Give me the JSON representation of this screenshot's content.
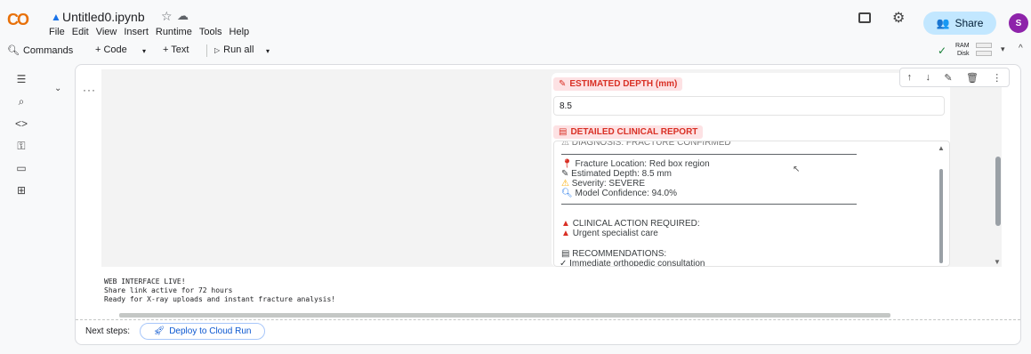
{
  "header": {
    "logo": "CO",
    "title": "Untitled0.ipynb",
    "menu": [
      "File",
      "Edit",
      "View",
      "Insert",
      "Runtime",
      "Tools",
      "Help"
    ],
    "share_label": "Share",
    "avatar_initial": "S"
  },
  "toolbar": {
    "commands_label": "Commands",
    "code_label": "+ Code",
    "text_label": "+ Text",
    "run_all_label": "Run all",
    "ram_label": "RAM",
    "disk_label": "Disk"
  },
  "cell": {
    "depth_label": "ESTIMATED DEPTH (mm)",
    "depth_value": "8.5",
    "report_label": "DETAILED CLINICAL REPORT",
    "report_cutoff_line": "DIAGNOSIS: FRACTURE CONFIRMED",
    "report_lines": [
      "Fracture Location: Red box region",
      "Estimated Depth: 8.5 mm",
      "Severity: SEVERE",
      "Model Confidence: 94.0%"
    ],
    "action_heading": "CLINICAL ACTION REQUIRED:",
    "action_item": "Urgent specialist care",
    "recommendations_heading": "RECOMMENDATIONS:",
    "recommendation_1": "✓ Immediate orthopedic consultation"
  },
  "output": {
    "line1": "WEB INTERFACE LIVE!",
    "line2": "Share link active for 72 hours",
    "line3": "Ready for X-ray uploads and instant fracture analysis!"
  },
  "footer": {
    "next_steps_label": "Next steps:",
    "deploy_label": "Deploy to Cloud Run"
  },
  "colors": {
    "accent_red": "#d93025",
    "chip_bg": "#fde2e4",
    "share_bg": "#c2e7ff",
    "avatar_bg": "#8e24aa"
  }
}
